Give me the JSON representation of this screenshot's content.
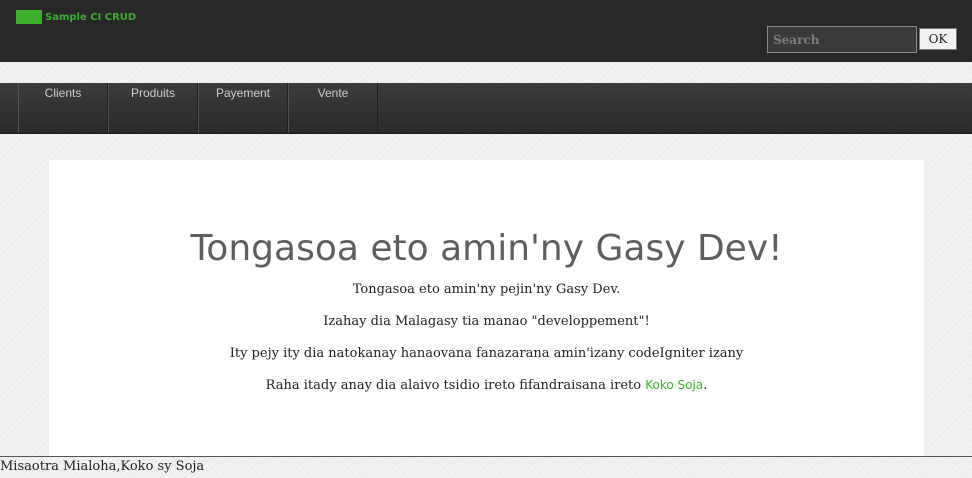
{
  "header": {
    "brand": "Sample CI CRUD",
    "search": {
      "placeholder": "Search",
      "value": ""
    },
    "ok_label": "OK"
  },
  "nav": {
    "items": [
      {
        "label": "Clients"
      },
      {
        "label": "Produits"
      },
      {
        "label": "Payement"
      },
      {
        "label": "Vente"
      }
    ]
  },
  "hero": {
    "title": "Tongasoa eto amin'ny Gasy Dev!",
    "line1": "Tongasoa eto amin'ny pejin'ny Gasy Dev.",
    "line2": "Izahay dia Malagasy tia manao \"developpement\"!",
    "line3": "Ity pejy ity dia natokanay hanaovana fanazarana amin'izany codeIgniter izany",
    "line4_prefix": "Raha itady anay dia alaivo tsidio ireto fifandraisana ireto ",
    "line4_link": "Koko Soja",
    "line4_suffix": "."
  },
  "footer": {
    "text": "Misaotra Mialoha,Koko sy Soja"
  },
  "colors": {
    "accent": "#3bb02a",
    "topbar": "#282828",
    "nav": "#333333"
  }
}
